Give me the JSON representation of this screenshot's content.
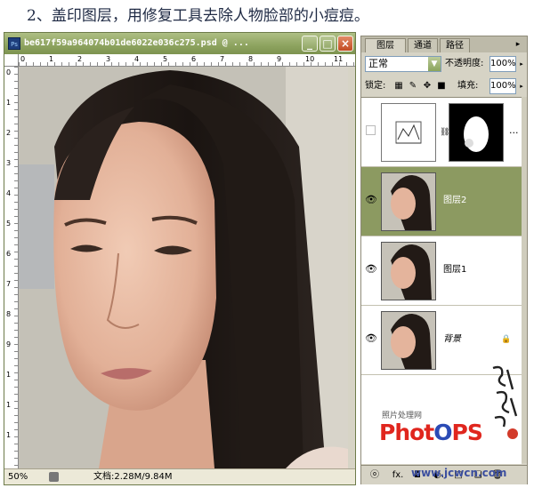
{
  "caption": "2、盖印图层，用修复工具去除人物脸部的小痘痘。",
  "document": {
    "title": "be617f59a964074b01de6022e036c275.psd @ ...",
    "app_icon": "Ps",
    "zoom": "50%",
    "doc_info": "文档:2.28M/9.84M",
    "ruler_top": [
      "0",
      "1",
      "2",
      "3",
      "4",
      "5",
      "6",
      "7",
      "8",
      "9",
      "10",
      "11"
    ],
    "ruler_left": [
      "0",
      "1",
      "2",
      "3",
      "4",
      "5",
      "6",
      "7",
      "8",
      "9",
      "1",
      "1",
      "1"
    ],
    "buttons": {
      "minimize": "_",
      "maximize": "□",
      "close": "×"
    }
  },
  "layers_panel": {
    "tabs": [
      "图层",
      "通道",
      "路径"
    ],
    "active_tab": 0,
    "menu_glyph": "▸",
    "blend_mode": "正常",
    "opacity_label": "不透明度:",
    "opacity_value": "100%",
    "lock_label": "锁定:",
    "fill_label": "填充:",
    "fill_value": "100%",
    "layers": [
      {
        "name": "",
        "visible": false,
        "selected": false,
        "adjustment": true
      },
      {
        "name": "图层2",
        "visible": true,
        "selected": true
      },
      {
        "name": "图层1",
        "visible": true,
        "selected": false
      },
      {
        "name": "背景",
        "visible": true,
        "selected": false,
        "locked": true
      }
    ],
    "bottom_glyphs": [
      "ⓞ",
      "fx.",
      "◘",
      "◐.",
      "□",
      "❏",
      "🗑"
    ],
    "more": "..."
  },
  "watermark": {
    "site_label": "照片处理网",
    "logo_red": "Phot",
    "logo_mid": "O",
    "logo_end": "PS",
    "url": "www.jcwcn.com"
  },
  "colors": {
    "titlebar": "#8da35f",
    "selected_layer": "#8c9a61",
    "panel_bg": "#d6d3c5"
  }
}
